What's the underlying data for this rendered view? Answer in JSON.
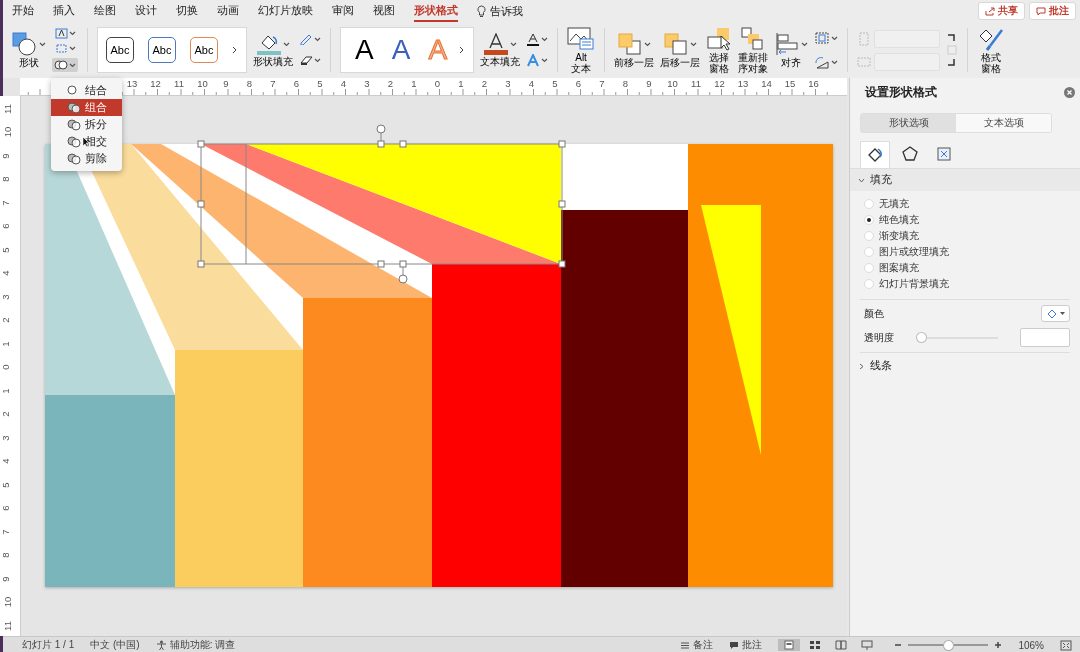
{
  "tabs": [
    {
      "label": "开始",
      "selected": false
    },
    {
      "label": "插入",
      "selected": false
    },
    {
      "label": "绘图",
      "selected": false
    },
    {
      "label": "设计",
      "selected": false
    },
    {
      "label": "切换",
      "selected": false
    },
    {
      "label": "动画",
      "selected": false
    },
    {
      "label": "幻灯片放映",
      "selected": false
    },
    {
      "label": "审阅",
      "selected": false
    },
    {
      "label": "视图",
      "selected": false
    },
    {
      "label": "形状格式",
      "selected": true
    }
  ],
  "tell_me": "告诉我",
  "share_button": "共享",
  "comments_button": "批注",
  "ribbon": {
    "shape_label": "形状",
    "style_samples": [
      "Abc",
      "Abc",
      "Abc"
    ],
    "shape_fill": "形状填充",
    "wordart_samples": [
      "A",
      "A",
      "A"
    ],
    "text_fill": "文本填充",
    "alt_text": [
      "Alt",
      "文本"
    ],
    "arrange": [
      {
        "kind": "forward",
        "lines": [
          "前移一层"
        ]
      },
      {
        "kind": "backward",
        "lines": [
          "后移一层"
        ]
      },
      {
        "kind": "pane",
        "lines": [
          "选择",
          "窗格"
        ]
      },
      {
        "kind": "reorder",
        "lines": [
          "重新排",
          "序对象"
        ]
      },
      {
        "kind": "align",
        "lines": [
          "对齐"
        ]
      }
    ],
    "format_pane": [
      "格式",
      "窗格"
    ]
  },
  "merge_menu": [
    {
      "label": "结合",
      "selected": false
    },
    {
      "label": "组合",
      "selected": true
    },
    {
      "label": "拆分",
      "selected": false
    },
    {
      "label": "相交",
      "selected": false
    },
    {
      "label": "剪除",
      "selected": false
    }
  ],
  "rulers": {
    "horizontal": [
      "13",
      "12",
      "11",
      "10",
      "9",
      "8",
      "7",
      "6",
      "5",
      "4",
      "3",
      "2",
      "1",
      "0",
      "1",
      "2",
      "3",
      "4",
      "5",
      "6",
      "7",
      "8",
      "9",
      "10",
      "11",
      "12",
      "13",
      "14",
      "15",
      "16"
    ],
    "vertical": [
      "11",
      "10",
      "9",
      "8",
      "7",
      "6",
      "5",
      "4",
      "3",
      "2",
      "1",
      "0",
      "1",
      "2",
      "3",
      "4",
      "5",
      "6",
      "7",
      "8",
      "9",
      "10",
      "11"
    ]
  },
  "pane": {
    "title": "设置形状格式",
    "tabs": [
      {
        "label": "形状选项",
        "selected": true
      },
      {
        "label": "文本选项",
        "selected": false
      }
    ],
    "icon_tabs": [
      {
        "kind": "fill",
        "selected": true
      },
      {
        "kind": "effects",
        "selected": false
      },
      {
        "kind": "size",
        "selected": false
      }
    ],
    "fill_section": {
      "title": "填充",
      "expanded": true,
      "options": [
        {
          "label": "无填充",
          "selected": false
        },
        {
          "label": "纯色填充",
          "selected": true
        },
        {
          "label": "渐变填充",
          "selected": false
        },
        {
          "label": "图片或纹理填充",
          "selected": false
        },
        {
          "label": "图案填充",
          "selected": false
        },
        {
          "label": "幻灯片背景填充",
          "selected": false
        }
      ]
    },
    "color_label": "颜色",
    "transparency": {
      "label": "透明度",
      "level": 0
    },
    "line_section": {
      "title": "线条",
      "expanded": false
    }
  },
  "status_bar": {
    "slide": "幻灯片 1 / 1",
    "language": "中文 (中国)",
    "accessibility": "辅助功能: 调查",
    "notes": "备注",
    "comments": "批注",
    "views": [
      {
        "kind": "normal",
        "selected": true
      },
      {
        "kind": "sorter",
        "selected": false
      },
      {
        "kind": "reading",
        "selected": false
      },
      {
        "kind": "slideshow",
        "selected": false
      }
    ],
    "zoom": {
      "level": 0.5,
      "reading": "106%"
    }
  }
}
